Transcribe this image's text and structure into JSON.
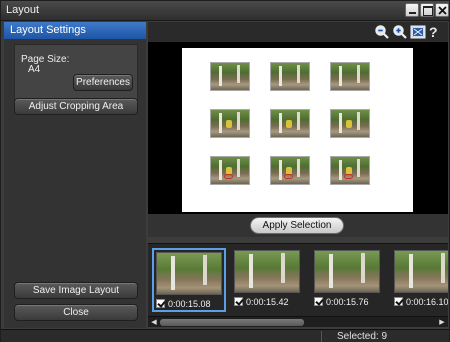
{
  "window": {
    "title": "Layout"
  },
  "left_panel": {
    "header": "Layout Settings",
    "page_size_label": "Page Size:",
    "page_size_value": "A4",
    "preferences_label": "Preferences",
    "adjust_crop_label": "Adjust Cropping Area",
    "save_layout_label": "Save Image Layout",
    "close_label": "Close"
  },
  "toolbar": {
    "icons": [
      "zoom-out-icon",
      "zoom-in-icon",
      "fit-to-window-icon",
      "help-icon"
    ],
    "help_glyph": "?"
  },
  "preview": {
    "grid_rows": 3,
    "grid_cols": 3,
    "apply_label": "Apply Selection"
  },
  "filmstrip": {
    "frames": [
      {
        "timecode": "0:00:15.08",
        "checked": true,
        "selected": true
      },
      {
        "timecode": "0:00:15.42",
        "checked": true,
        "selected": false
      },
      {
        "timecode": "0:00:15.76",
        "checked": true,
        "selected": false
      },
      {
        "timecode": "0:00:16.10",
        "checked": true,
        "selected": false
      }
    ]
  },
  "status": {
    "selected_text": "Selected: 9"
  },
  "colors": {
    "accent": "#2f67b8",
    "selection": "#5d9fe6"
  }
}
